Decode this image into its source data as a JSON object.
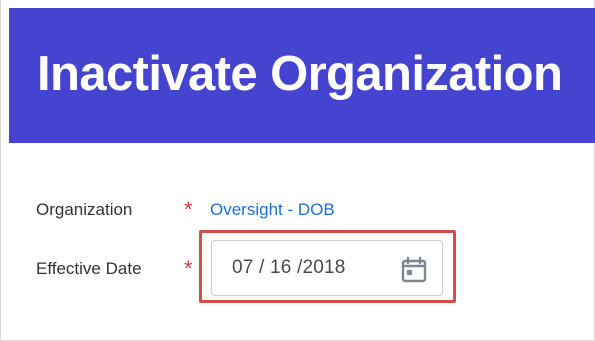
{
  "header": {
    "title": "Inactivate Organization",
    "background_color": "#4444d0"
  },
  "form": {
    "organization": {
      "label": "Organization",
      "required_marker": "*",
      "value": "Oversight - DOB",
      "value_color": "#1d6fcf"
    },
    "effective_date": {
      "label": "Effective Date",
      "required_marker": "*",
      "value": "07 / 16 /2018",
      "icon": "calendar-icon"
    }
  },
  "annotation": {
    "highlight_color": "#d84b4b"
  }
}
